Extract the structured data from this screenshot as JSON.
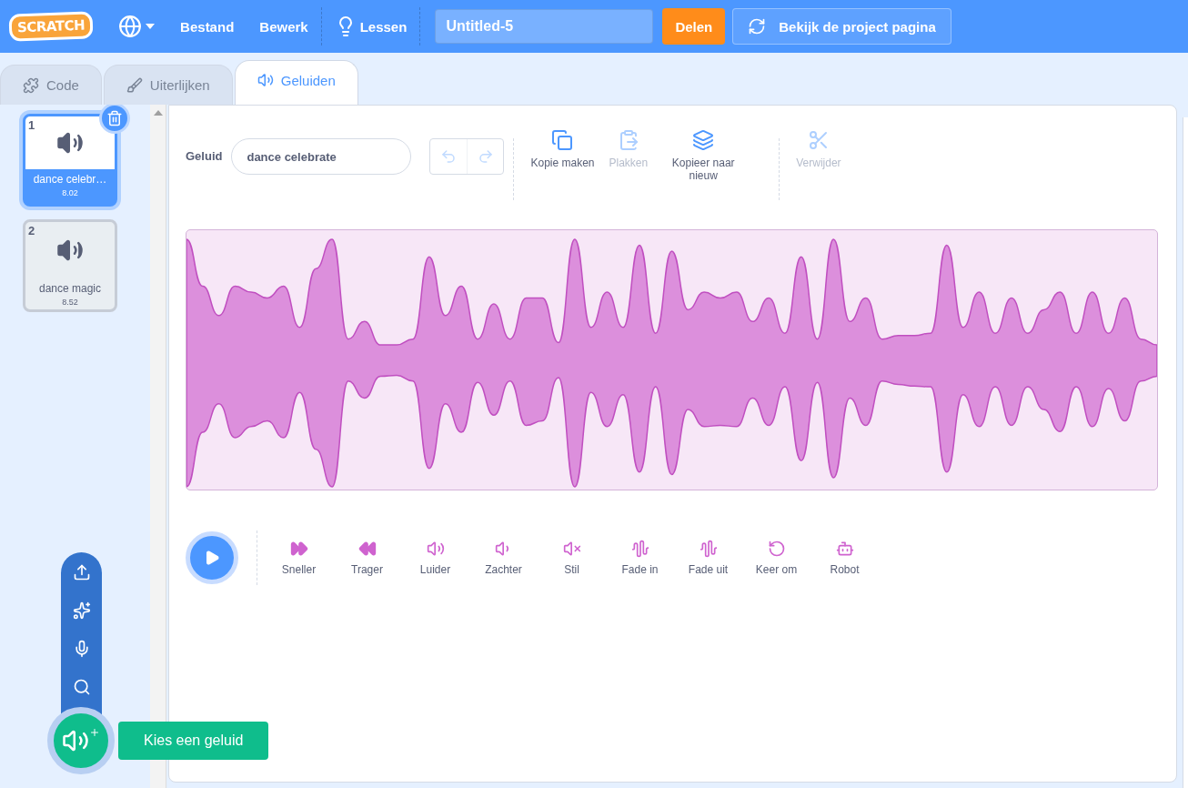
{
  "menubar": {
    "logo": "SCRATCH",
    "menus": [
      "Bestand",
      "Bewerk"
    ],
    "tutorials": "Lessen",
    "project_title": "Untitled-5",
    "share": "Delen",
    "project_page": "Bekijk de project pagina"
  },
  "tabs": [
    {
      "label": "Code",
      "selected": false
    },
    {
      "label": "Uiterlijken",
      "selected": false
    },
    {
      "label": "Geluiden",
      "selected": true
    }
  ],
  "sounds": [
    {
      "number": "1",
      "name": "dance celebr…",
      "duration": "8.02",
      "selected": true
    },
    {
      "number": "2",
      "name": "dance magic",
      "duration": "8.52",
      "selected": false
    }
  ],
  "editor": {
    "sound_label": "Geluid",
    "sound_name": "dance celebrate",
    "undo_disabled": true,
    "redo_disabled": true,
    "edit_actions": [
      {
        "kind": "copy",
        "label": "Kopie maken",
        "disabled": false
      },
      {
        "kind": "paste",
        "label": "Plakken",
        "disabled": true
      },
      {
        "kind": "copy-new",
        "label": "Kopieer naar nieuw",
        "disabled": false
      },
      {
        "kind": "delete",
        "label": "Verwijder",
        "disabled": true
      }
    ],
    "effects": [
      {
        "kind": "faster",
        "label": "Sneller"
      },
      {
        "kind": "slower",
        "label": "Trager"
      },
      {
        "kind": "louder",
        "label": "Luider"
      },
      {
        "kind": "softer",
        "label": "Zachter"
      },
      {
        "kind": "mute",
        "label": "Stil"
      },
      {
        "kind": "fade-in",
        "label": "Fade in"
      },
      {
        "kind": "fade-out",
        "label": "Fade uit"
      },
      {
        "kind": "reverse",
        "label": "Keer om"
      },
      {
        "kind": "robot",
        "label": "Robot"
      }
    ]
  },
  "add_sound_tooltip": "Kies een geluid"
}
